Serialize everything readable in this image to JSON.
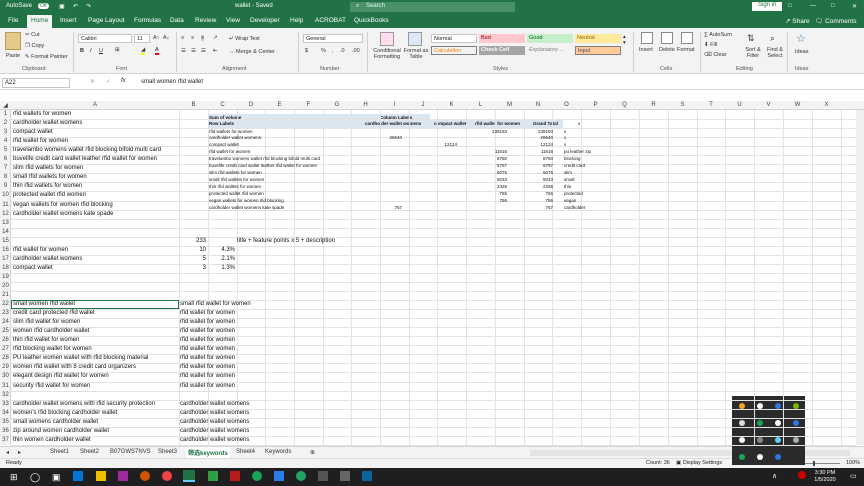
{
  "titlebar": {
    "autosave": "AutoSave",
    "autosave_state": "Off",
    "title": "wallet - Saved",
    "search_placeholder": "Search",
    "signin": "Sign in"
  },
  "tabs": [
    "File",
    "Home",
    "Insert",
    "Page Layout",
    "Formulas",
    "Data",
    "Review",
    "View",
    "Developer",
    "Help",
    "ACROBAT",
    "QuickBooks"
  ],
  "share": "Share",
  "comments": "Comments",
  "ribbon": {
    "cut": "Cut",
    "copy": "Copy",
    "format_painter": "Format Painter",
    "paste": "Paste",
    "clipboard": "Clipboard",
    "font_name": "Calibri",
    "font_size": "11",
    "font": "Font",
    "wrap_text": "Wrap Text",
    "merge_center": "Merge & Center",
    "alignment": "Alignment",
    "number_format": "General",
    "number": "Number",
    "conditional_formatting": "Conditional Formatting",
    "format_as_table": "Format as Table",
    "styles": "Styles",
    "style_cells": [
      "Normal",
      "Bad",
      "Good",
      "Neutral",
      "Calculation",
      "Check Cell",
      "Explanatory ...",
      "Input"
    ],
    "insert": "Insert",
    "delete": "Delete",
    "format": "Format",
    "cells": "Cells",
    "autosum": "AutoSum",
    "fill": "Fill",
    "clear": "Clear",
    "sort_filter": "Sort & Filter",
    "find_select": "Find & Select",
    "editing": "Editing",
    "ideas": "Ideas",
    "ideas_group": "Ideas"
  },
  "formula_bar": {
    "name_box": "A22",
    "fx": "fx",
    "value": "small women rfid wallet"
  },
  "columns": [
    "A",
    "B",
    "C",
    "D",
    "E",
    "F",
    "G",
    "H",
    "I",
    "J",
    "K",
    "L",
    "M",
    "N",
    "O",
    "P",
    "Q",
    "R",
    "S",
    "T",
    "U",
    "V",
    "W",
    "X"
  ],
  "rows": [
    "1",
    "2",
    "3",
    "4",
    "5",
    "6",
    "7",
    "8",
    "9",
    "10",
    "11",
    "12",
    "13",
    "14",
    "15",
    "16",
    "17",
    "18",
    "19",
    "20",
    "21",
    "22",
    "23",
    "24",
    "25",
    "26",
    "27",
    "28",
    "29",
    "30",
    "31",
    "32",
    "33",
    "34",
    "35",
    "36",
    "37"
  ],
  "colA": [
    {
      "r": 1,
      "t": "rfid wallets for women"
    },
    {
      "r": 2,
      "t": "cardholder wallet womens"
    },
    {
      "r": 3,
      "t": "compact wallet"
    },
    {
      "r": 4,
      "t": "rfid wallet for women"
    },
    {
      "r": 5,
      "t": "travelambo womens wallet rfid blocking bifold multi card"
    },
    {
      "r": 6,
      "t": "buvelife credit card wallet leather rfid wallet for women"
    },
    {
      "r": 7,
      "t": "slim rfid wallets for women"
    },
    {
      "r": 8,
      "t": "small rfid wallets for women"
    },
    {
      "r": 9,
      "t": "thin rfid wallets for women"
    },
    {
      "r": 10,
      "t": "protected wallet rfid women"
    },
    {
      "r": 11,
      "t": "vegan wallets for women rfid blocking"
    },
    {
      "r": 12,
      "t": "cardholder wallet womens kate spade"
    },
    {
      "r": 16,
      "t": "rfid wallet for women"
    },
    {
      "r": 17,
      "t": "cardholder wallet womens"
    },
    {
      "r": 18,
      "t": "compact wallet"
    },
    {
      "r": 22,
      "t": "small women rfid wallet"
    },
    {
      "r": 23,
      "t": "credit card protected rfid wallet"
    },
    {
      "r": 24,
      "t": "slim rfid wallet for women"
    },
    {
      "r": 25,
      "t": "women rfid cardholder wallet"
    },
    {
      "r": 26,
      "t": "thin rfid wallet for women"
    },
    {
      "r": 27,
      "t": "rfid blocking wallet for women"
    },
    {
      "r": 28,
      "t": "PU leather women wallet with rfid blocking material"
    },
    {
      "r": 29,
      "t": "women rfid wallet with 8 credit card organizers"
    },
    {
      "r": 30,
      "t": "elegant design rfid wallet for women"
    },
    {
      "r": 31,
      "t": "security rfid wallet for women"
    },
    {
      "r": 33,
      "t": "cardholder wallet womens with rfid security protection"
    },
    {
      "r": 34,
      "t": "women's rfid blocking cardholder wallet"
    },
    {
      "r": 35,
      "t": "small womens cardholder wallet"
    },
    {
      "r": 36,
      "t": "zip around women cardholder wallet"
    },
    {
      "r": 37,
      "t": "thin women cardholder wallet"
    }
  ],
  "colB": [
    {
      "r": 15,
      "t": "233"
    },
    {
      "r": 16,
      "t": "10"
    },
    {
      "r": 17,
      "t": "5"
    },
    {
      "r": 18,
      "t": "3"
    }
  ],
  "colC_pct": [
    {
      "r": 16,
      "t": "4.3%"
    },
    {
      "r": 17,
      "t": "2.1%"
    },
    {
      "r": 18,
      "t": "1.3%"
    }
  ],
  "note": {
    "r": 15,
    "t": "title + feature points x 5 + description"
  },
  "colB_text": [
    {
      "r": 22,
      "t": "small rfid wallet for women"
    },
    {
      "r": 23,
      "t": "rfid wallet for women"
    },
    {
      "r": 24,
      "t": "rfid wallet for women"
    },
    {
      "r": 25,
      "t": "rfid wallet for women"
    },
    {
      "r": 26,
      "t": "rfid wallet for women"
    },
    {
      "r": 27,
      "t": "rfid wallet for women"
    },
    {
      "r": 28,
      "t": "rfid wallet for women"
    },
    {
      "r": 29,
      "t": "rfid wallet for women"
    },
    {
      "r": 30,
      "t": "rfid wallet for women"
    },
    {
      "r": 31,
      "t": "rfid wallet for women"
    },
    {
      "r": 33,
      "t": "cardholder wallet womens"
    },
    {
      "r": 34,
      "t": "cardholder wallet womens"
    },
    {
      "r": 35,
      "t": "cardholder wallet womens"
    },
    {
      "r": 36,
      "t": "cardholder wallet womens"
    },
    {
      "r": 37,
      "t": "cardholder wallet womens"
    }
  ],
  "pivot": {
    "sum_label": "Sum of volume",
    "col_labels": "Column Labels",
    "row_labels": "Row Labels",
    "col_headers": [
      "cardholder wallet womens",
      "compact wallet",
      "rfid wallet for women",
      "Grand Total"
    ],
    "x_header": "x",
    "rows": [
      {
        "label": "rfid wallets for women",
        "cw": "",
        "cp": "",
        "rf": "239193",
        "gt": "239193",
        "x": "x"
      },
      {
        "label": "cardholder wallet womens",
        "cw": "26540",
        "cp": "",
        "rf": "",
        "gt": "26540",
        "x": "x"
      },
      {
        "label": "compact wallet",
        "cw": "",
        "cp": "12124",
        "rf": "",
        "gt": "12124",
        "x": "x"
      },
      {
        "label": "rfid wallet for women",
        "cw": "",
        "cp": "",
        "rf": "11616",
        "gt": "11616",
        "x": "pu leather zip"
      },
      {
        "label": "travelambo womens wallet rfid blocking bifold multi card",
        "cw": "",
        "cp": "",
        "rf": "8750",
        "gt": "8750",
        "x": "blocking"
      },
      {
        "label": "buvelife credit card wallet leather rfid wallet for women",
        "cw": "",
        "cp": "",
        "rf": "6797",
        "gt": "6797",
        "x": "credit card"
      },
      {
        "label": "slim rfid wallets for women",
        "cw": "",
        "cp": "",
        "rf": "6075",
        "gt": "6075",
        "x": "slim"
      },
      {
        "label": "small rfid wallets for women",
        "cw": "",
        "cp": "",
        "rf": "5033",
        "gt": "5033",
        "x": "small"
      },
      {
        "label": "thin rfid wallets for women",
        "cw": "",
        "cp": "",
        "rf": "2336",
        "gt": "2336",
        "x": "thin"
      },
      {
        "label": "protected wallet rfid women",
        "cw": "",
        "cp": "",
        "rf": "765",
        "gt": "765",
        "x": "protected"
      },
      {
        "label": "vegan wallets for women rfid blocking",
        "cw": "",
        "cp": "",
        "rf": "756",
        "gt": "756",
        "x": "vegan"
      },
      {
        "label": "cardholder wallet womens kate spade",
        "cw": "767",
        "cp": "",
        "rf": "",
        "gt": "767",
        "x": "cardholder"
      }
    ]
  },
  "sheets": [
    "Sheet1",
    "Sheet2",
    "B07GWS7NVS",
    "Sheet3",
    "筛选keywords",
    "Sheet4",
    "Keywords"
  ],
  "active_sheet_index": 4,
  "status": {
    "ready": "Ready",
    "count": "Count: 36",
    "display_settings": "Display Settings",
    "zoom": "100%"
  },
  "taskbar": {
    "time": "3:30 PM",
    "date": "1/5/2020"
  },
  "colors": {
    "excel_green": "#217346",
    "bad_bg": "#ffc7ce",
    "good_bg": "#c6efce",
    "neutral_bg": "#ffeb9c",
    "calc_color": "#fa7d00",
    "check_bg": "#a5a5a5",
    "input_bg": "#ffcc99",
    "pivot_header": "#dce6f1"
  }
}
